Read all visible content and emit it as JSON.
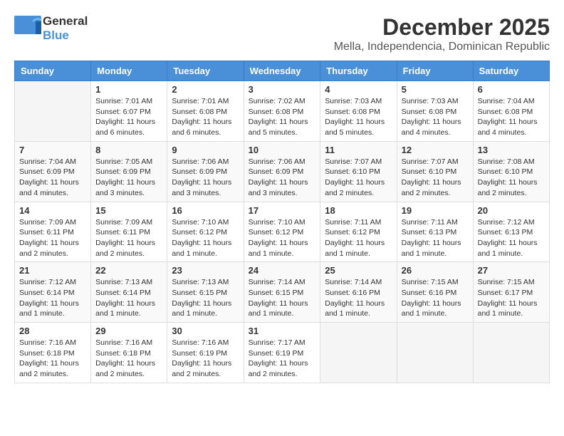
{
  "header": {
    "logo": {
      "general": "General",
      "blue": "Blue"
    },
    "title": "December 2025",
    "location": "Mella, Independencia, Dominican Republic"
  },
  "weekdays": [
    "Sunday",
    "Monday",
    "Tuesday",
    "Wednesday",
    "Thursday",
    "Friday",
    "Saturday"
  ],
  "weeks": [
    [
      {
        "day": "",
        "info": ""
      },
      {
        "day": "1",
        "info": "Sunrise: 7:01 AM\nSunset: 6:07 PM\nDaylight: 11 hours\nand 6 minutes."
      },
      {
        "day": "2",
        "info": "Sunrise: 7:01 AM\nSunset: 6:08 PM\nDaylight: 11 hours\nand 6 minutes."
      },
      {
        "day": "3",
        "info": "Sunrise: 7:02 AM\nSunset: 6:08 PM\nDaylight: 11 hours\nand 5 minutes."
      },
      {
        "day": "4",
        "info": "Sunrise: 7:03 AM\nSunset: 6:08 PM\nDaylight: 11 hours\nand 5 minutes."
      },
      {
        "day": "5",
        "info": "Sunrise: 7:03 AM\nSunset: 6:08 PM\nDaylight: 11 hours\nand 4 minutes."
      },
      {
        "day": "6",
        "info": "Sunrise: 7:04 AM\nSunset: 6:08 PM\nDaylight: 11 hours\nand 4 minutes."
      }
    ],
    [
      {
        "day": "7",
        "info": "Sunrise: 7:04 AM\nSunset: 6:09 PM\nDaylight: 11 hours\nand 4 minutes."
      },
      {
        "day": "8",
        "info": "Sunrise: 7:05 AM\nSunset: 6:09 PM\nDaylight: 11 hours\nand 3 minutes."
      },
      {
        "day": "9",
        "info": "Sunrise: 7:06 AM\nSunset: 6:09 PM\nDaylight: 11 hours\nand 3 minutes."
      },
      {
        "day": "10",
        "info": "Sunrise: 7:06 AM\nSunset: 6:09 PM\nDaylight: 11 hours\nand 3 minutes."
      },
      {
        "day": "11",
        "info": "Sunrise: 7:07 AM\nSunset: 6:10 PM\nDaylight: 11 hours\nand 2 minutes."
      },
      {
        "day": "12",
        "info": "Sunrise: 7:07 AM\nSunset: 6:10 PM\nDaylight: 11 hours\nand 2 minutes."
      },
      {
        "day": "13",
        "info": "Sunrise: 7:08 AM\nSunset: 6:10 PM\nDaylight: 11 hours\nand 2 minutes."
      }
    ],
    [
      {
        "day": "14",
        "info": "Sunrise: 7:09 AM\nSunset: 6:11 PM\nDaylight: 11 hours\nand 2 minutes."
      },
      {
        "day": "15",
        "info": "Sunrise: 7:09 AM\nSunset: 6:11 PM\nDaylight: 11 hours\nand 2 minutes."
      },
      {
        "day": "16",
        "info": "Sunrise: 7:10 AM\nSunset: 6:12 PM\nDaylight: 11 hours\nand 1 minute."
      },
      {
        "day": "17",
        "info": "Sunrise: 7:10 AM\nSunset: 6:12 PM\nDaylight: 11 hours\nand 1 minute."
      },
      {
        "day": "18",
        "info": "Sunrise: 7:11 AM\nSunset: 6:12 PM\nDaylight: 11 hours\nand 1 minute."
      },
      {
        "day": "19",
        "info": "Sunrise: 7:11 AM\nSunset: 6:13 PM\nDaylight: 11 hours\nand 1 minute."
      },
      {
        "day": "20",
        "info": "Sunrise: 7:12 AM\nSunset: 6:13 PM\nDaylight: 11 hours\nand 1 minute."
      }
    ],
    [
      {
        "day": "21",
        "info": "Sunrise: 7:12 AM\nSunset: 6:14 PM\nDaylight: 11 hours\nand 1 minute."
      },
      {
        "day": "22",
        "info": "Sunrise: 7:13 AM\nSunset: 6:14 PM\nDaylight: 11 hours\nand 1 minute."
      },
      {
        "day": "23",
        "info": "Sunrise: 7:13 AM\nSunset: 6:15 PM\nDaylight: 11 hours\nand 1 minute."
      },
      {
        "day": "24",
        "info": "Sunrise: 7:14 AM\nSunset: 6:15 PM\nDaylight: 11 hours\nand 1 minute."
      },
      {
        "day": "25",
        "info": "Sunrise: 7:14 AM\nSunset: 6:16 PM\nDaylight: 11 hours\nand 1 minute."
      },
      {
        "day": "26",
        "info": "Sunrise: 7:15 AM\nSunset: 6:16 PM\nDaylight: 11 hours\nand 1 minute."
      },
      {
        "day": "27",
        "info": "Sunrise: 7:15 AM\nSunset: 6:17 PM\nDaylight: 11 hours\nand 1 minute."
      }
    ],
    [
      {
        "day": "28",
        "info": "Sunrise: 7:16 AM\nSunset: 6:18 PM\nDaylight: 11 hours\nand 2 minutes."
      },
      {
        "day": "29",
        "info": "Sunrise: 7:16 AM\nSunset: 6:18 PM\nDaylight: 11 hours\nand 2 minutes."
      },
      {
        "day": "30",
        "info": "Sunrise: 7:16 AM\nSunset: 6:19 PM\nDaylight: 11 hours\nand 2 minutes."
      },
      {
        "day": "31",
        "info": "Sunrise: 7:17 AM\nSunset: 6:19 PM\nDaylight: 11 hours\nand 2 minutes."
      },
      {
        "day": "",
        "info": ""
      },
      {
        "day": "",
        "info": ""
      },
      {
        "day": "",
        "info": ""
      }
    ]
  ]
}
